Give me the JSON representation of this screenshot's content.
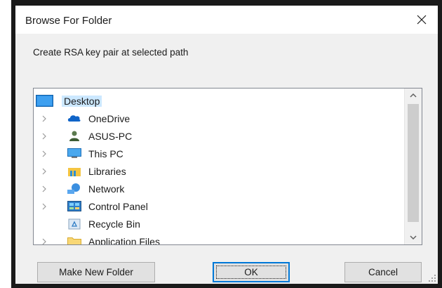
{
  "dialog": {
    "title": "Browse For Folder",
    "instruction": "Create RSA key pair at selected path"
  },
  "tree": {
    "root": {
      "label": "Desktop",
      "icon": "desktop-icon",
      "selected": true
    },
    "items": [
      {
        "label": "OneDrive",
        "icon": "cloud-icon",
        "expandable": true
      },
      {
        "label": "ASUS-PC",
        "icon": "user-icon",
        "expandable": true
      },
      {
        "label": "This PC",
        "icon": "computer-icon",
        "expandable": true
      },
      {
        "label": "Libraries",
        "icon": "libraries-icon",
        "expandable": true
      },
      {
        "label": "Network",
        "icon": "network-icon",
        "expandable": true
      },
      {
        "label": "Control Panel",
        "icon": "control-panel-icon",
        "expandable": true
      },
      {
        "label": "Recycle Bin",
        "icon": "recycle-bin-icon",
        "expandable": false
      },
      {
        "label": "Application Files",
        "icon": "folder-icon",
        "expandable": true
      }
    ]
  },
  "buttons": {
    "make_new_folder": "Make New Folder",
    "ok": "OK",
    "cancel": "Cancel"
  },
  "colors": {
    "accent": "#0078d7",
    "dialog_bg": "#f0f0f0",
    "selection": "#cce8ff"
  }
}
